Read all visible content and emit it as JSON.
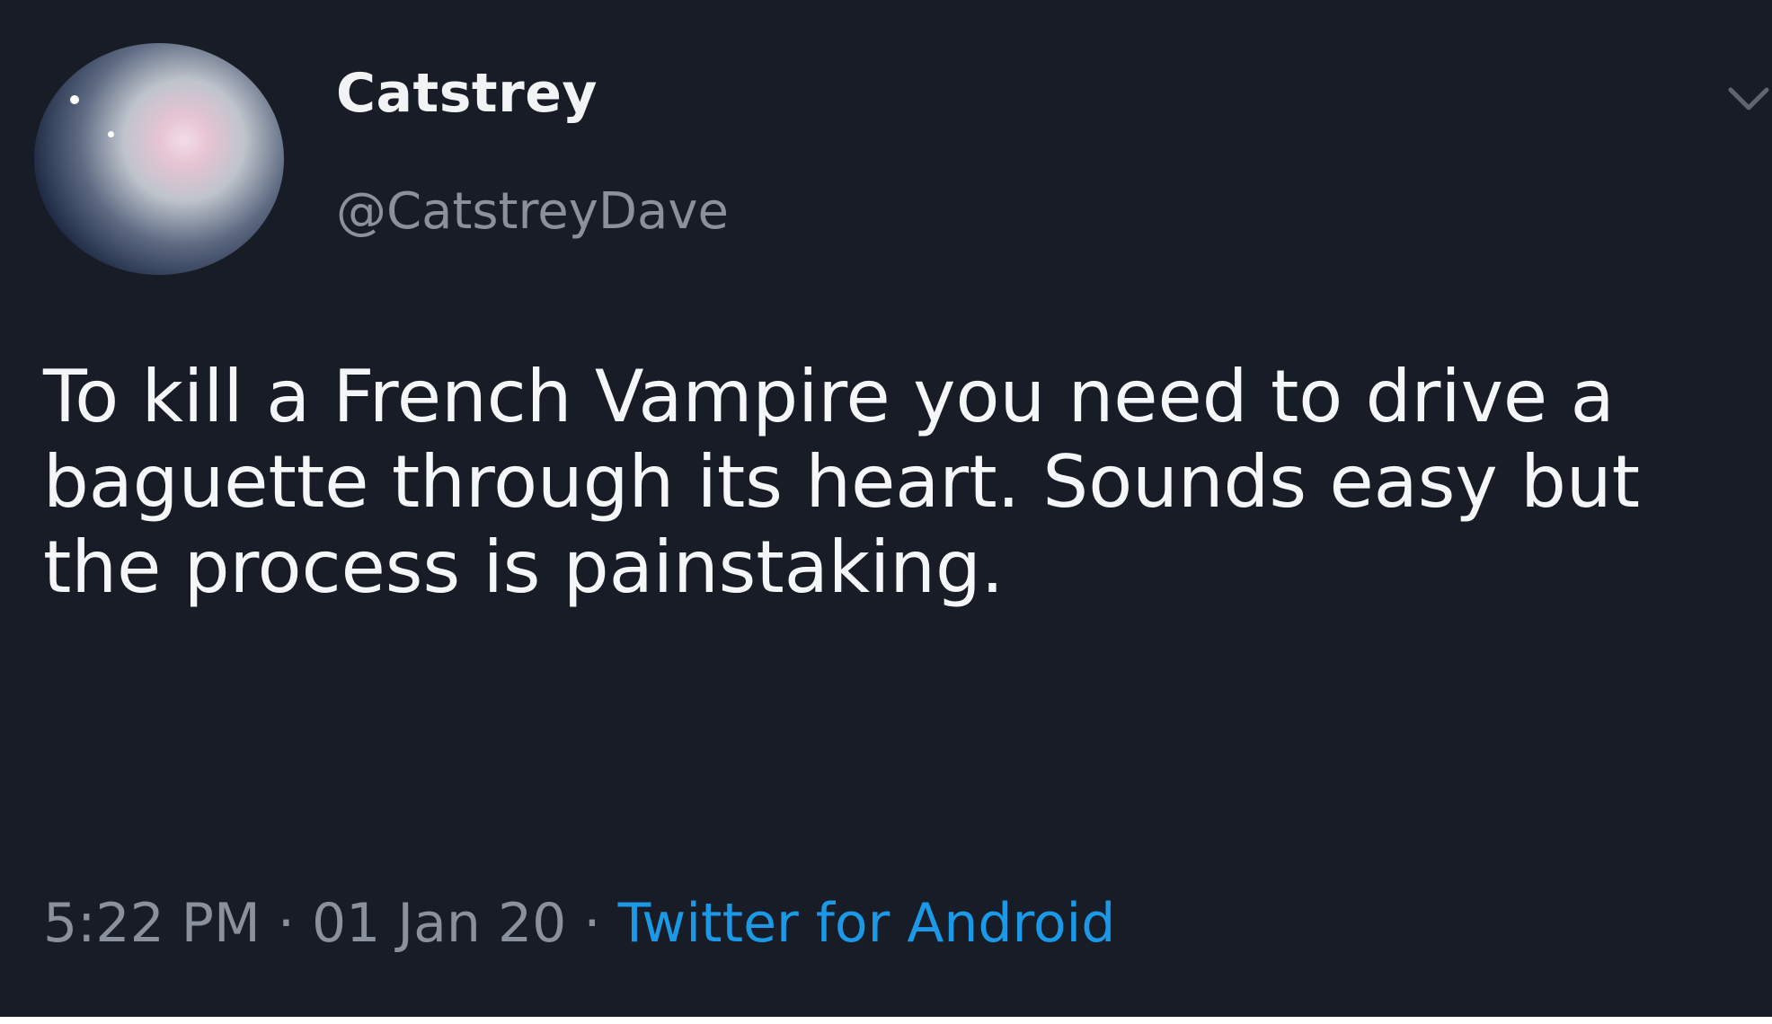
{
  "tweet": {
    "display_name": "Catstrey",
    "handle": "@CatstreyDave",
    "text": "To kill a French Vampire you need to drive a baguette through its heart. Sounds easy but the process is painstaking.",
    "time": "5:22 PM",
    "separator": "·",
    "date": "01 Jan 20",
    "source": "Twitter for Android",
    "menu_icon": "chevron-down-icon"
  },
  "colors": {
    "background": "#171c27",
    "text": "#f5f6f8",
    "secondary_text": "#8a919c",
    "link": "#1c99e6"
  }
}
